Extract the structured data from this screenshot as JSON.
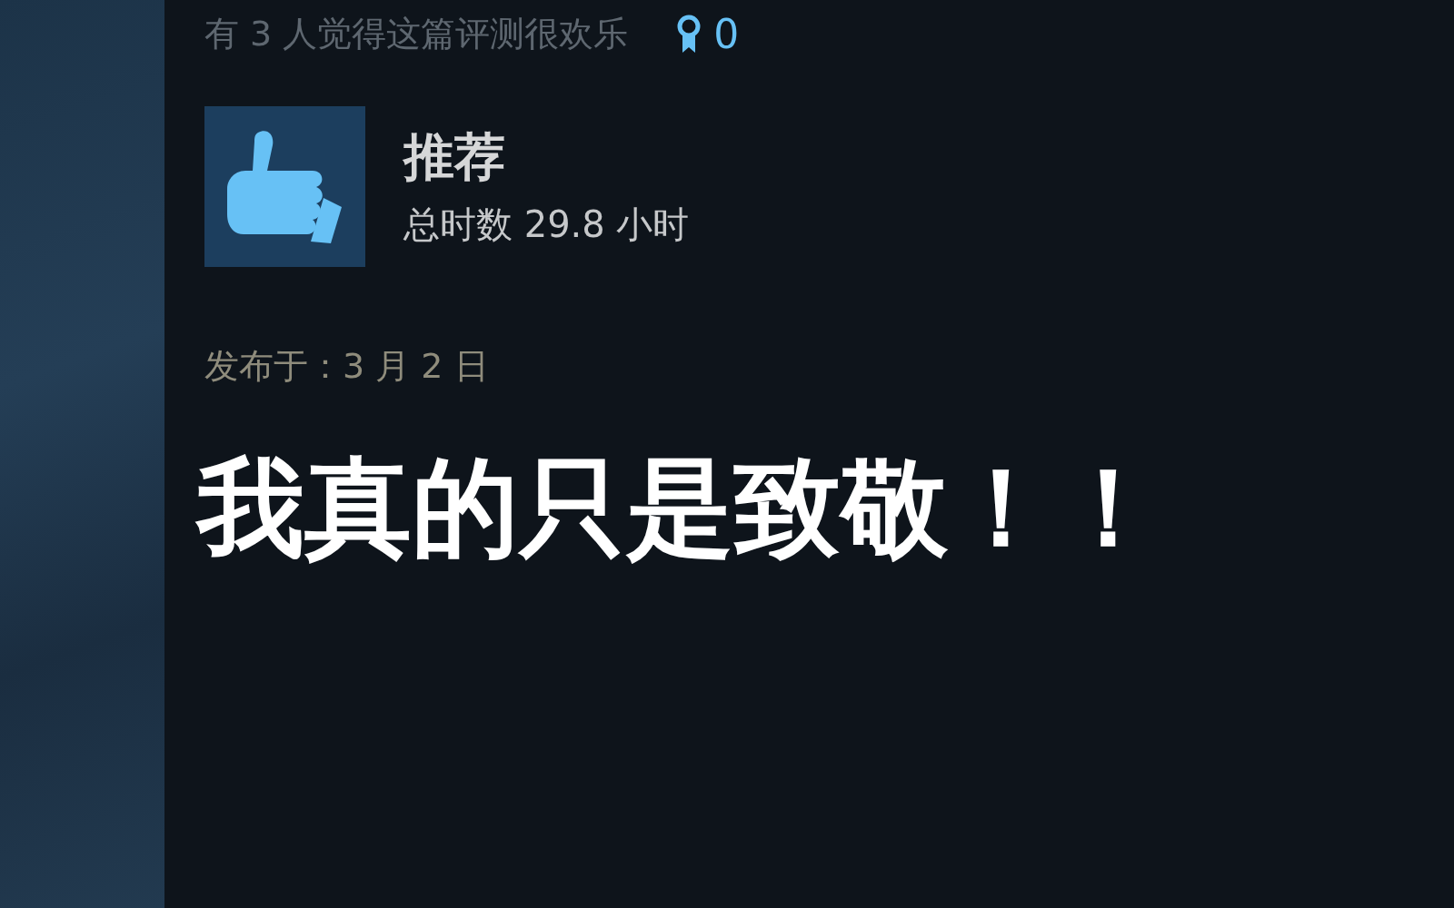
{
  "helpful": {
    "text": "有 3 人觉得这篇评测很欢乐",
    "awards": "0"
  },
  "review": {
    "recommended": true,
    "verdict": "推荐",
    "hours": "总时数 29.8 小时",
    "posted": "发布于：3 月 2 日",
    "body": "我真的只是致敬！！"
  }
}
